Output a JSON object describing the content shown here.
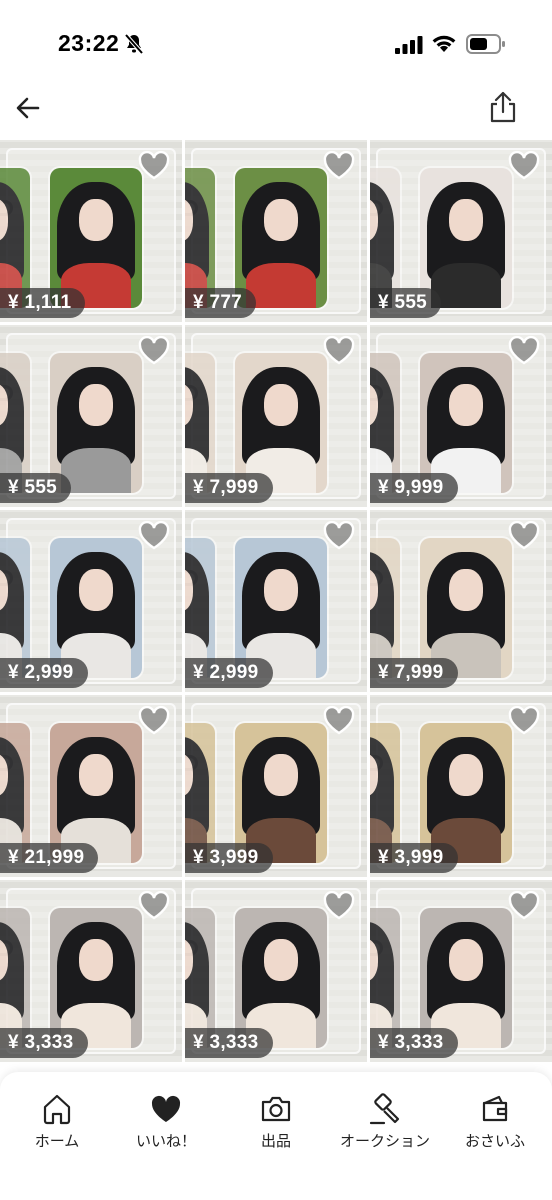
{
  "status_bar": {
    "time": "23:22"
  },
  "header": {
    "back_icon": "arrow-left-icon",
    "share_icon": "share-icon"
  },
  "items": [
    {
      "price": "¥ 1,111"
    },
    {
      "price": "¥ 777"
    },
    {
      "price": "¥ 555"
    },
    {
      "price": "¥ 555"
    },
    {
      "price": "¥ 7,999"
    },
    {
      "price": "¥ 9,999"
    },
    {
      "price": "¥ 2,999"
    },
    {
      "price": "¥ 2,999"
    },
    {
      "price": "¥ 7,999"
    },
    {
      "price": "¥ 21,999"
    },
    {
      "price": "¥ 3,999"
    },
    {
      "price": "¥ 3,999"
    },
    {
      "price": "¥ 3,333"
    },
    {
      "price": "¥ 3,333"
    },
    {
      "price": "¥ 3,333"
    }
  ],
  "tabbar": {
    "home": "ホーム",
    "likes": "いいね！",
    "sell": "出品",
    "auction": "オークション",
    "wallet": "おさいふ"
  },
  "colors": {
    "price_badge": "#323232",
    "background": "#ffffff",
    "heart_fill": "#ffffff"
  }
}
